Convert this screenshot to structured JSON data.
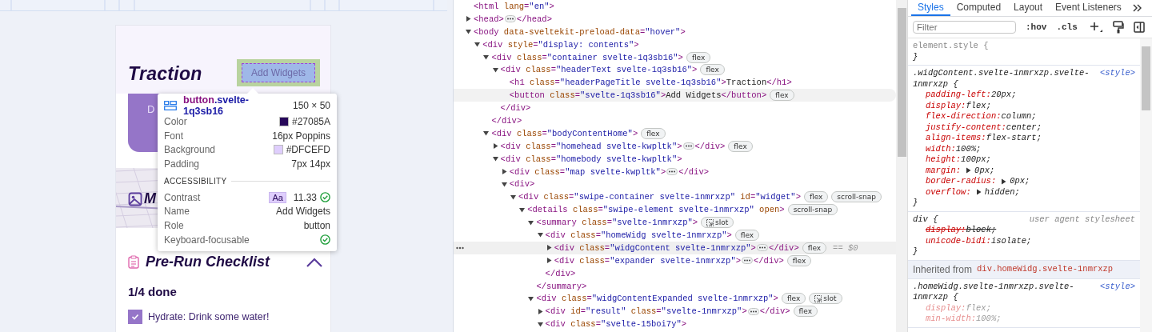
{
  "viewport": {
    "app": {
      "title": "Traction",
      "add_button": "Add Widgets",
      "card_text": "D",
      "map_title": "M",
      "checklist": {
        "title": "Pre-Run Checklist",
        "expanded": true,
        "progress": "1/4 done",
        "items": [
          {
            "label": "Hydrate: Drink some water!",
            "checked": true
          }
        ]
      }
    },
    "inspect_tooltip": {
      "tag": "button",
      "class": ".svelte-1q3sb16",
      "size": "150 × 50",
      "properties": [
        {
          "label": "Color",
          "value": "#27085A",
          "color": "#27085a"
        },
        {
          "label": "Font",
          "value": "16px Poppins"
        },
        {
          "label": "Background",
          "value": "#DFCEFD",
          "color": "#dfcefd"
        },
        {
          "label": "Padding",
          "value": "7px 14px"
        }
      ],
      "accessibility_heading": "ACCESSIBILITY",
      "accessibility": [
        {
          "label": "Contrast",
          "badge": "Aa",
          "value": "11.33",
          "passed": true
        },
        {
          "label": "Name",
          "value": "Add Widgets",
          "passed": false
        },
        {
          "label": "Role",
          "value": "button",
          "passed": false
        },
        {
          "label": "Keyboard-focusable",
          "passed": true
        }
      ]
    }
  },
  "elements_panel": {
    "tree": [
      {
        "open_tag": "<html lang=\"en\">",
        "selected": false,
        "hovered": false
      },
      {
        "open_tag": "<head>",
        "expanded": false,
        "close_tag": "</head>",
        "selected": false,
        "hovered": false
      },
      {
        "open_tag": "<body data-sveltekit-preload-data=\"hover\">",
        "expanded": true,
        "selected": false,
        "hovered": false,
        "children": [
          {
            "open_tag": "<div style=\"display: contents\">",
            "expanded": true,
            "selected": false,
            "hovered": false,
            "children": [
              {
                "open_tag": "<div class=\"container svelte-1q3sb16\">",
                "expanded": true,
                "close_tag": "</div>",
                "badges": [
                  {
                    "label": "flex",
                    "kind": "plain"
                  }
                ],
                "selected": false,
                "hovered": false,
                "children": [
                  {
                    "open_tag": "<div class=\"headerText svelte-1q3sb16\">",
                    "expanded": true,
                    "close_tag": "</div>",
                    "badges": [
                      {
                        "label": "flex",
                        "kind": "plain"
                      }
                    ],
                    "selected": false,
                    "hovered": false,
                    "children": [
                      {
                        "open_tag": "<h1 class=\"headerPageTitle svelte-1q3sb16\">Traction</h1>",
                        "selected": false,
                        "hovered": false
                      },
                      {
                        "open_tag": "<button class=\"svelte-1q3sb16\">Add Widgets</button>",
                        "badges": [
                          {
                            "label": "flex",
                            "kind": "plain"
                          }
                        ],
                        "selected": false,
                        "hovered": true
                      }
                    ]
                  }
                ]
              },
              {
                "open_tag": "<div class=\"bodyContentHome\">",
                "expanded": true,
                "badges": [
                  {
                    "label": "flex",
                    "kind": "plain"
                  }
                ],
                "selected": false,
                "hovered": false,
                "children": [
                  {
                    "open_tag": "<div class=\"homehead svelte-kwpltk\">",
                    "expanded": false,
                    "close_tag": "</div>",
                    "badges": [
                      {
                        "label": "flex",
                        "kind": "plain"
                      }
                    ],
                    "selected": false,
                    "hovered": false
                  },
                  {
                    "open_tag": "<div class=\"homebody svelte-kwpltk\">",
                    "expanded": true,
                    "selected": false,
                    "hovered": false,
                    "children": [
                      {
                        "open_tag": "<div class=\"map svelte-kwpltk\">",
                        "expanded": false,
                        "close_tag": "</div>",
                        "selected": false,
                        "hovered": false
                      },
                      {
                        "open_tag": "<div>",
                        "expanded": true,
                        "selected": false,
                        "hovered": false,
                        "children": [
                          {
                            "open_tag": "<div class=\"swipe-container svelte-1nmrxzp\" id=\"widget\">",
                            "expanded": true,
                            "badges": [
                              {
                                "label": "flex",
                                "kind": "plain"
                              },
                              {
                                "label": "scroll-snap",
                                "kind": "plain"
                              }
                            ],
                            "selected": false,
                            "hovered": false,
                            "children": [
                              {
                                "open_tag": "<details class=\"swipe-element svelte-1nmrxzp\" open>",
                                "expanded": true,
                                "badges": [
                                  {
                                    "label": "scroll-snap",
                                    "kind": "plain"
                                  }
                                ],
                                "selected": false,
                                "hovered": false,
                                "children": [
                                  {
                                    "open_tag": "<summary class=\"svelte-1nmrxzp\">",
                                    "expanded": true,
                                    "close_tag": "</summary>",
                                    "badges": [
                                      {
                                        "label": "slot",
                                        "kind": "slot"
                                      }
                                    ],
                                    "selected": false,
                                    "hovered": false,
                                    "children": [
                                      {
                                        "open_tag": "<div class=\"homeWidg svelte-1nmrxzp\">",
                                        "expanded": true,
                                        "close_tag": "</div>",
                                        "badges": [
                                          {
                                            "label": "flex",
                                            "kind": "plain"
                                          }
                                        ],
                                        "selected": false,
                                        "hovered": false,
                                        "children": [
                                          {
                                            "open_tag": "<div class=\"widgContent svelte-1nmrxzp\">",
                                            "expanded": false,
                                            "close_tag": "</div>",
                                            "badges": [
                                              {
                                                "label": "flex",
                                                "kind": "plain"
                                              }
                                            ],
                                            "selected": true,
                                            "hovered": false,
                                            "suffix": "== $0"
                                          },
                                          {
                                            "open_tag": "<div class=\"expander svelte-1nmrxzp\">",
                                            "expanded": false,
                                            "close_tag": "</div>",
                                            "badges": [
                                              {
                                                "label": "flex",
                                                "kind": "plain"
                                              }
                                            ],
                                            "selected": false,
                                            "hovered": false
                                          }
                                        ]
                                      }
                                    ]
                                  },
                                  {
                                    "open_tag": "<div class=\"widgContentExpanded svelte-1nmrxzp\">",
                                    "expanded": true,
                                    "badges": [
                                      {
                                        "label": "flex",
                                        "kind": "plain"
                                      },
                                      {
                                        "label": "slot",
                                        "kind": "slot"
                                      }
                                    ],
                                    "selected": false,
                                    "hovered": false,
                                    "children": [
                                      {
                                        "open_tag": "<div id=\"result\" class=\"svelte-1nmrxzp\">",
                                        "expanded": false,
                                        "close_tag": "</div>",
                                        "badges": [
                                          {
                                            "label": "flex",
                                            "kind": "plain"
                                          }
                                        ],
                                        "selected": false,
                                        "hovered": false
                                      },
                                      {
                                        "open_tag": "<div class=\"svelte-15boi7y\">",
                                        "expanded": true,
                                        "selected": false,
                                        "hovered": false
                                      }
                                    ]
                                  }
                                ]
                              }
                            ]
                          }
                        ]
                      }
                    ]
                  }
                ]
              }
            ]
          }
        ]
      }
    ]
  },
  "styles_panel": {
    "tabs": [
      {
        "label": "Styles",
        "selected": true
      },
      {
        "label": "Computed",
        "selected": false
      },
      {
        "label": "Layout",
        "selected": false
      },
      {
        "label": "Event Listeners",
        "selected": false
      }
    ],
    "filter": {
      "placeholder": "Filter"
    },
    "toggles": [
      ":hov",
      ".cls"
    ],
    "rules": [
      {
        "kind": "inline_rule",
        "selector": "element.style {",
        "close": "}"
      },
      {
        "kind": "author_rule",
        "selector": ".widgContent.svelte-1nmrxzp.svelte-1nmrxzp {",
        "source": "<style>",
        "close": "}",
        "declarations": [
          {
            "name": "padding-left:",
            "value": "20px;",
            "expandable": false,
            "overridden": false,
            "inactive": false
          },
          {
            "name": "display:",
            "value": "flex;",
            "expandable": false,
            "overridden": false,
            "inactive": false
          },
          {
            "name": "flex-direction:",
            "value": "column;",
            "expandable": false,
            "overridden": false,
            "inactive": false
          },
          {
            "name": "justify-content:",
            "value": "center;",
            "expandable": false,
            "overridden": false,
            "inactive": false
          },
          {
            "name": "align-items:",
            "value": "flex-start;",
            "expandable": false,
            "overridden": false,
            "inactive": false
          },
          {
            "name": "width:",
            "value": "100%;",
            "expandable": false,
            "overridden": false,
            "inactive": false
          },
          {
            "name": "height:",
            "value": "100px;",
            "expandable": false,
            "overridden": false,
            "inactive": false
          },
          {
            "name": "margin:",
            "value": "0px;",
            "expandable": true,
            "overridden": false,
            "inactive": false
          },
          {
            "name": "border-radius:",
            "value": "0px;",
            "expandable": true,
            "overridden": false,
            "inactive": false
          },
          {
            "name": "overflow:",
            "value": "hidden;",
            "expandable": true,
            "overridden": false,
            "inactive": false
          }
        ]
      },
      {
        "kind": "user_agent_rule",
        "selector": "div {",
        "source": "user agent stylesheet",
        "close": "}",
        "declarations": [
          {
            "name": "display:",
            "value": "block;",
            "expandable": false,
            "overridden": true,
            "inactive": false
          },
          {
            "name": "unicode-bidi:",
            "value": "isolate;",
            "expandable": false,
            "overridden": false,
            "inactive": false
          }
        ]
      },
      {
        "kind": "inherited",
        "label": "Inherited from",
        "selector": "div.homeWidg.svelte-1nmrxzp"
      },
      {
        "kind": "author_rule",
        "selector": ".homeWidg.svelte-1nmrxzp.svelte-1nmrxzp {",
        "source": "<style>",
        "declarations": [
          {
            "name": "display:",
            "value": "flex;",
            "expandable": false,
            "overridden": false,
            "inactive": true
          },
          {
            "name": "min-width:",
            "value": "100%;",
            "expandable": false,
            "overridden": false,
            "inactive": true
          }
        ]
      }
    ]
  }
}
